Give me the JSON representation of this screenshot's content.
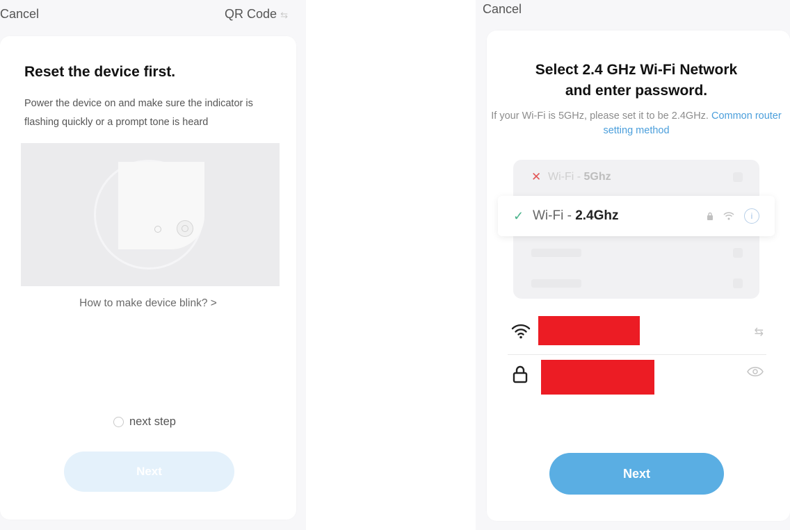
{
  "left": {
    "cancel_label": "Cancel",
    "qr_label": "QR Code",
    "title": "Reset the device first.",
    "description": "Power the device on and make sure the indicator is flashing quickly or a prompt tone is heard",
    "blink_link": "How to make device blink? >",
    "next_step_label": "next step",
    "next_step_checked": false,
    "next_button": "Next",
    "next_enabled": false
  },
  "right": {
    "cancel_label": "Cancel",
    "title_line1": "Select 2.4 GHz Wi-Fi Network",
    "title_line2": "and enter password.",
    "hint_text": "If your Wi-Fi is 5GHz, please set it to be 2.4GHz.",
    "hint_link": "Common router setting method",
    "networks": [
      {
        "prefix": "Wi-Fi - ",
        "band": "5Ghz",
        "status": "unsupported"
      },
      {
        "prefix": "Wi-Fi - ",
        "band": "2.4Ghz",
        "status": "supported"
      }
    ],
    "ssid_redacted": true,
    "password_redacted": true,
    "next_button": "Next"
  },
  "colors": {
    "accent": "#5aaee3",
    "link": "#4a9edb",
    "redaction": "#ec1c24",
    "disabled_button": "#e4f1fb",
    "check": "#49b38b",
    "cross": "#e25656"
  },
  "icons": [
    "switch-icon",
    "wifi-icon",
    "lock-icon",
    "eye-icon",
    "info-icon",
    "check-icon",
    "cross-icon"
  ]
}
